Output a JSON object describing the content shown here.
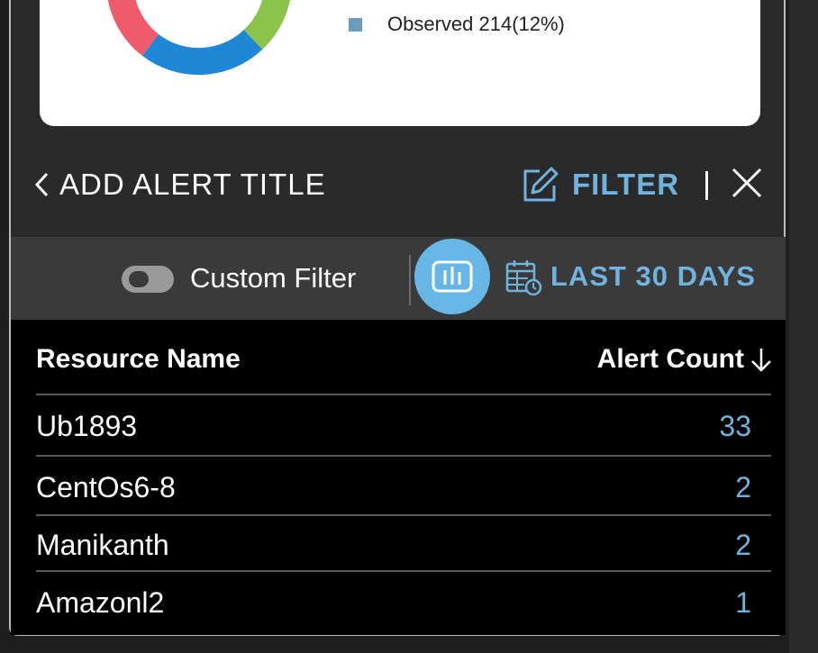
{
  "chart_data": {
    "type": "pie",
    "title": "",
    "slices": [
      {
        "label": "Observed",
        "count": 214,
        "percent": 12,
        "color": "#6a9cc0"
      }
    ],
    "visible_arc_colors": [
      "#ef5b6b",
      "#8bc34a",
      "#1e88d6"
    ]
  },
  "legend": {
    "observed_label": "Observed 214(12%)",
    "observed_color": "#6a9cc0"
  },
  "header": {
    "back_label": "ADD ALERT TITLE",
    "filter_label": "FILTER",
    "separator": "|"
  },
  "toolbar": {
    "custom_filter_label": "Custom Filter",
    "custom_filter_on": false,
    "range_label": "LAST 30 DAYS"
  },
  "table": {
    "columns": [
      "Resource Name",
      "Alert Count"
    ],
    "sort": "descending",
    "rows": [
      {
        "name": "Ub1893",
        "count": "33"
      },
      {
        "name": "CentOs6-8",
        "count": "2"
      },
      {
        "name": "Manikanth",
        "count": "2"
      },
      {
        "name": "Amazonl2",
        "count": "1"
      }
    ]
  },
  "colors": {
    "accent": "#6fb3de",
    "background": "#1f1f1f",
    "toolbar_bg": "#3a3a3a",
    "table_bg": "#000000"
  }
}
